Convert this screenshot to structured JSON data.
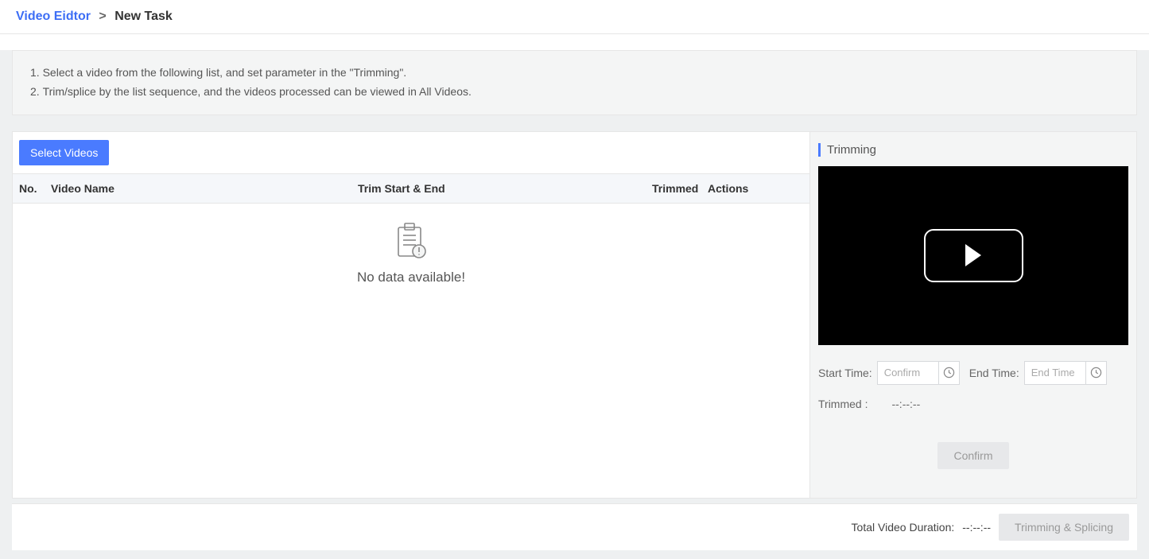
{
  "breadcrumb": {
    "link": "Video Eidtor",
    "sep": ">",
    "current": "New Task"
  },
  "info": {
    "items": [
      "Select a video from the following list, and set parameter in the \"Trimming\".",
      "Trim/splice by the list sequence, and the videos processed can be viewed in All Videos."
    ]
  },
  "left": {
    "select_btn": "Select Videos",
    "headers": {
      "no": "No.",
      "name": "Video Name",
      "trim": "Trim Start & End",
      "trimmed": "Trimmed",
      "actions": "Actions"
    },
    "empty": "No data available!"
  },
  "right": {
    "title": "Trimming",
    "start_label": "Start Time:",
    "start_placeholder": "Confirm",
    "end_label": "End Time:",
    "end_placeholder": "End Time",
    "trimmed_label": "Trimmed :",
    "trimmed_value": "--:--:--",
    "confirm": "Confirm"
  },
  "footer": {
    "total_label": "Total Video Duration:",
    "total_value": "--:--:--",
    "action": "Trimming & Splicing"
  }
}
